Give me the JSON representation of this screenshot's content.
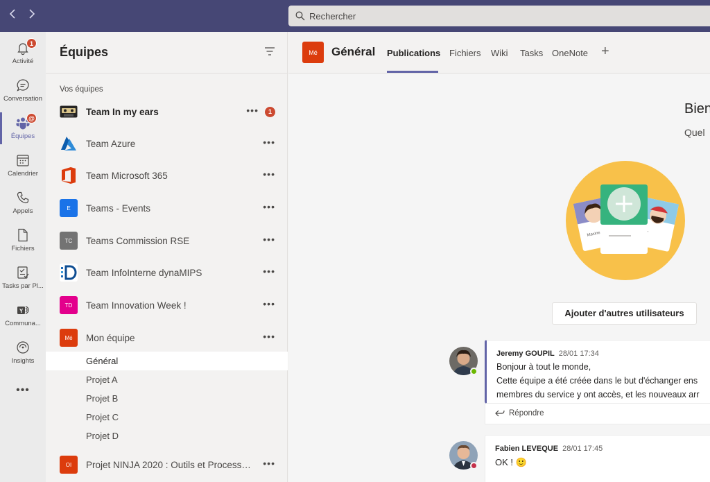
{
  "topbar": {
    "back_icon": "chevron-left-icon",
    "forward_icon": "chevron-right-icon",
    "search_placeholder": "Rechercher"
  },
  "rail": {
    "items": [
      {
        "label": "Activité",
        "icon": "bell-icon",
        "badge": "1"
      },
      {
        "label": "Conversation",
        "icon": "chat-icon"
      },
      {
        "label": "Équipes",
        "icon": "teams-icon",
        "badge": "@",
        "active": true
      },
      {
        "label": "Calendrier",
        "icon": "calendar-icon"
      },
      {
        "label": "Appels",
        "icon": "phone-icon"
      },
      {
        "label": "Fichiers",
        "icon": "file-icon"
      },
      {
        "label": "Tasks par Pl...",
        "icon": "tasks-icon"
      },
      {
        "label": "Communa...",
        "icon": "yammer-icon"
      },
      {
        "label": "Insights",
        "icon": "insights-icon"
      }
    ],
    "more_label": "•••"
  },
  "teams_panel": {
    "title": "Équipes",
    "section_label": "Vos équipes",
    "teams": [
      {
        "name": "Team In my ears",
        "avatar_text": "",
        "avatar_color": "#252423",
        "bold": true,
        "notif": "1"
      },
      {
        "name": "Team Azure",
        "avatar_text": "",
        "avatar_color": "#0078d4"
      },
      {
        "name": "Team Microsoft 365",
        "avatar_text": "",
        "avatar_color": "#dc3c0d"
      },
      {
        "name": "Teams - Events",
        "avatar_text": "E",
        "avatar_color": "#1a73e8"
      },
      {
        "name": "Teams Commission RSE",
        "avatar_text": "TC",
        "avatar_color": "#737373"
      },
      {
        "name": "Team InfoInterne dynaMIPS",
        "avatar_text": "",
        "avatar_color": "#ffffff"
      },
      {
        "name": "Team Innovation Week !",
        "avatar_text": "TD",
        "avatar_color": "#e3008c"
      },
      {
        "name": "Mon équipe",
        "avatar_text": "Mé",
        "avatar_color": "#dc3c0d"
      }
    ],
    "channels": [
      "Général",
      "Projet A",
      "Projet B",
      "Projet C",
      "Projet D"
    ],
    "last_team": {
      "name": "Projet NINJA 2020 : Outils et Process ...",
      "avatar_text": "OI",
      "avatar_color": "#dc3c0d"
    },
    "more_label": "•••"
  },
  "main": {
    "channel_avatar": "Mé",
    "channel_title": "Général",
    "tabs": [
      "Publications",
      "Fichiers",
      "Wiki",
      "Tasks",
      "OneNote"
    ],
    "add_tab": "+",
    "welcome_title": "Bien",
    "welcome_sub": "Quel",
    "illustration": {
      "card_left_label": "Maxine",
      "card_right_label": "y"
    },
    "add_users_button": "Ajouter d'autres utilisateurs",
    "messages": [
      {
        "author": "Jeremy GOUPIL",
        "time": "28/01 17:34",
        "lines": [
          "Bonjour à tout le monde,",
          "Cette équipe a été créée dans le but d'échanger ens",
          "membres du service y ont accès, et les nouveaux arr"
        ],
        "reply_label": "Répondre",
        "presence_color": "#6bb700"
      },
      {
        "author": "Fabien LEVEQUE",
        "time": "28/01 17:45",
        "lines": [
          "OK ! 🙂"
        ],
        "presence_color": "#c4314b"
      }
    ]
  },
  "colors": {
    "accent": "#6264a7",
    "topbar": "#464775",
    "badge": "#cc4a31"
  }
}
